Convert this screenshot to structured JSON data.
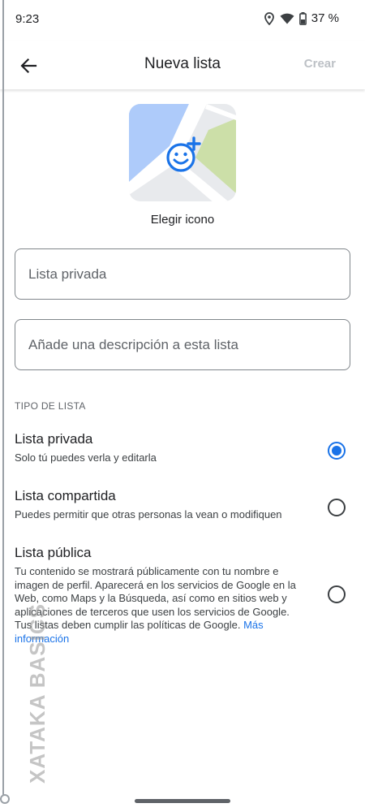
{
  "status_bar": {
    "time": "9:23",
    "battery_text": "37 %",
    "icons": [
      "location-icon",
      "wifi-icon",
      "battery-icon"
    ]
  },
  "app_bar": {
    "back_icon": "arrow-back-icon",
    "title": "Nueva lista",
    "action_label": "Crear"
  },
  "list_icon": {
    "label": "Elegir icono",
    "icon": "add-emoji-icon"
  },
  "form": {
    "name_placeholder": "Lista privada",
    "name_value": "",
    "description_placeholder": "Añade una descripción a esta lista",
    "description_value": ""
  },
  "list_type": {
    "header": "TIPO DE LISTA",
    "selected": "private",
    "options": [
      {
        "id": "private",
        "title": "Lista privada",
        "description": "Solo tú puedes verla y editarla"
      },
      {
        "id": "shared",
        "title": "Lista compartida",
        "description": "Puedes permitir que otras personas la vean o modifiquen"
      },
      {
        "id": "public",
        "title": "Lista pública",
        "description": "Tu contenido se mostrará públicamente con tu nombre e imagen de perfil. Aparecerá en los servicios de Google en la Web, como Maps y la Búsqueda, así como en sitios web y aplicaciones de terceros que usen los servicios de Google. Tus listas deben cumplir las políticas de Google.",
        "link": "Más información"
      }
    ]
  },
  "watermark": "XATAKA BASICS",
  "colors": {
    "accent": "#1a73e8",
    "disabled_action": "#bdc1c6",
    "map_blue": "#aecbfa",
    "map_green": "#ccdfa8"
  }
}
